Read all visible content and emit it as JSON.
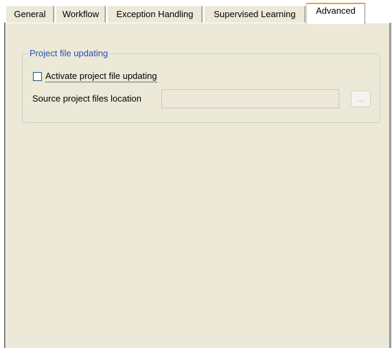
{
  "tabs": [
    {
      "label": "General",
      "active": false
    },
    {
      "label": "Workflow",
      "active": false
    },
    {
      "label": "Exception Handling",
      "active": false
    },
    {
      "label": "Supervised Learning",
      "active": false
    },
    {
      "label": "Advanced",
      "active": true
    }
  ],
  "group": {
    "title": "Project file updating",
    "checkbox": {
      "label": "Activate project file updating",
      "checked": false
    },
    "source_location": {
      "label": "Source project files location",
      "value": "",
      "enabled": false
    },
    "browse_button": {
      "label": "...",
      "enabled": false
    }
  },
  "colors": {
    "panel_background": "#ece9d8",
    "group_title": "#2b4fb5",
    "active_tab_highlight": "#f0a030"
  }
}
